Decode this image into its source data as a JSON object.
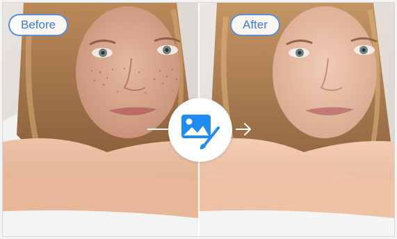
{
  "comparison": {
    "before_label": "Before",
    "after_label": "After"
  },
  "icons": {
    "center_badge": "image-edit-icon",
    "arrow": "arrow-right-icon"
  },
  "colors": {
    "tag_text": "#3f7bd0",
    "tag_border": "#5a8fd6",
    "badge_blue": "#1e8cf0"
  }
}
